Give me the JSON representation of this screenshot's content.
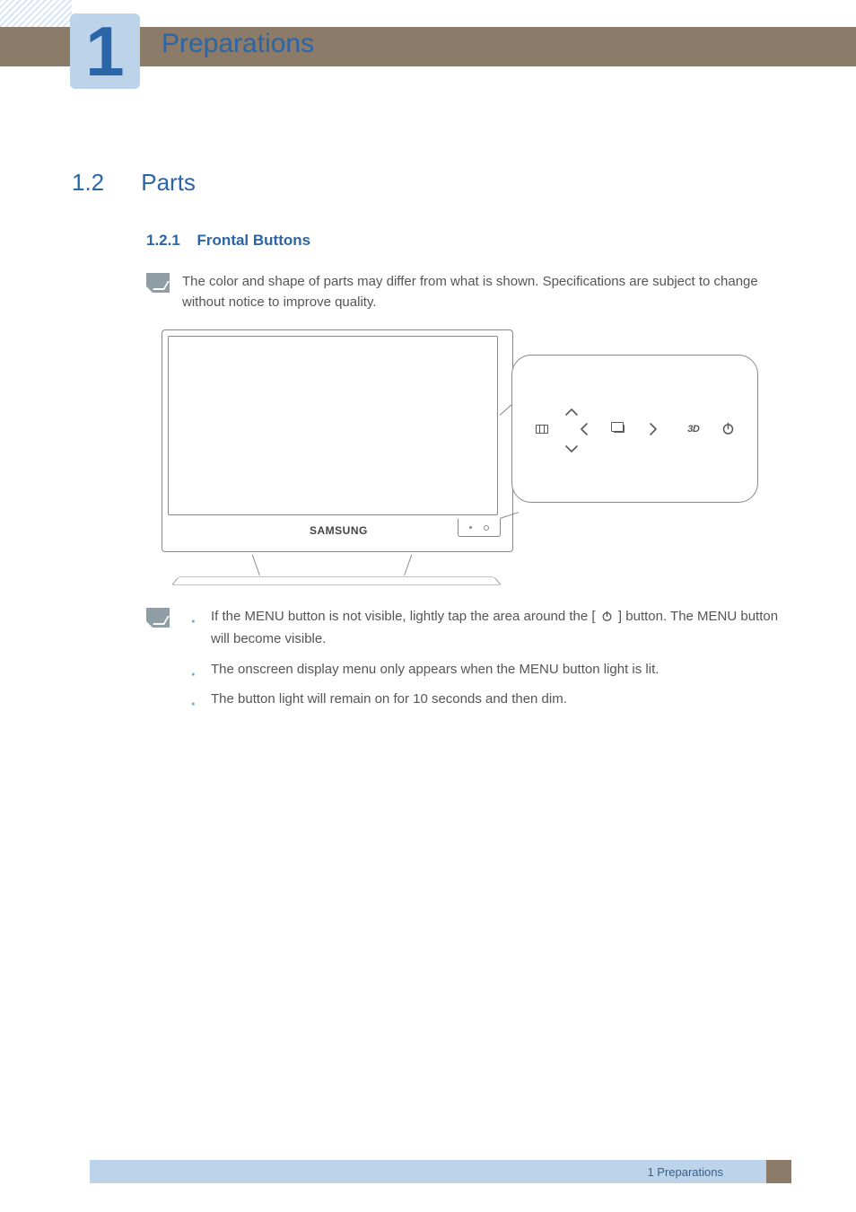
{
  "chapter": {
    "number": "1",
    "title": "Preparations"
  },
  "section": {
    "number": "1.2",
    "title": "Parts"
  },
  "subsection": {
    "number": "1.2.1",
    "title": "Frontal Buttons"
  },
  "intro_note": "The color and shape of parts may differ from what is shown. Specifications are subject to change without notice to improve quality.",
  "diagram": {
    "logo": "SAMSUNG",
    "icons": {
      "menu": "menu-button-icon",
      "up": "up-arrow-icon",
      "down": "down-arrow-icon",
      "left": "left-arrow-icon",
      "right": "right-arrow-icon",
      "source": "source-enter-icon",
      "three_d": "3D",
      "power": "power-icon"
    }
  },
  "bullets": {
    "b1_a": "If the MENU button is not visible, lightly tap the area around the [",
    "b1_b": "] button. The MENU button will become visible.",
    "b2": "The onscreen display menu only appears when the MENU button light is lit.",
    "b3": "The button light will remain on for 10 seconds and then dim."
  },
  "footer": {
    "text": "1 Preparations"
  }
}
